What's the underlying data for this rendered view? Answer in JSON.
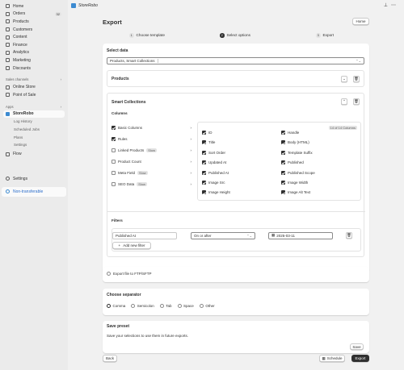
{
  "sidebar": {
    "items": [
      {
        "label": "Home",
        "icon": "home-icon"
      },
      {
        "label": "Orders",
        "icon": "orders-icon",
        "badge": "32"
      },
      {
        "label": "Products",
        "icon": "tag-icon"
      },
      {
        "label": "Customers",
        "icon": "person-icon"
      },
      {
        "label": "Content",
        "icon": "content-icon"
      },
      {
        "label": "Finance",
        "icon": "bank-icon"
      },
      {
        "label": "Analytics",
        "icon": "chart-icon"
      },
      {
        "label": "Marketing",
        "icon": "target-icon"
      },
      {
        "label": "Discounts",
        "icon": "discount-icon"
      }
    ],
    "sales_channels_label": "Sales channels",
    "channels": [
      {
        "label": "Online Store",
        "icon": "store-icon"
      },
      {
        "label": "Point of Sale",
        "icon": "pos-icon"
      }
    ],
    "apps_label": "Apps",
    "app": {
      "label": "StoreRobo",
      "icon": "app-icon"
    },
    "app_sub": [
      "Log History",
      "Scheduled Jobs",
      "Plans",
      "Settings"
    ],
    "flow": "Flow",
    "settings": "Settings",
    "non_transferable": "Non-transferable"
  },
  "topbar": {
    "title": "StoreRobo"
  },
  "page": {
    "title": "Export",
    "home_button": "Home"
  },
  "steps": [
    {
      "num": "1",
      "label": "Choose template"
    },
    {
      "num": "2",
      "label": "Select options"
    },
    {
      "num": "3",
      "label": "Export"
    }
  ],
  "select_data": {
    "heading": "Select data",
    "value": "Products, Smart Collections",
    "products": "Products",
    "smart_collections": "Smart Collections",
    "columns_label": "Columns",
    "groups": [
      {
        "label": "Basic Columns",
        "checked": true
      },
      {
        "label": "Rules",
        "checked": true
      },
      {
        "label": "Linked Products",
        "checked": false,
        "pill": "Slow"
      },
      {
        "label": "Product Count",
        "checked": false
      },
      {
        "label": "Meta Field",
        "checked": false,
        "pill": "Slow"
      },
      {
        "label": "SEO Data",
        "checked": false,
        "pill": "Slow"
      }
    ],
    "count_badge": "14 of 14 Columns",
    "columns_left": [
      "ID",
      "Title",
      "Sort Order",
      "Updated At",
      "Published At",
      "Image Src",
      "Image Height"
    ],
    "columns_right": [
      "Handle",
      "Body (HTML)",
      "Template Suffix",
      "Published",
      "Published Scope",
      "Image Width",
      "Image Alt Text"
    ],
    "filters_label": "Filters",
    "filter_field": "Published At",
    "filter_op": "On or after",
    "filter_value": "2025-03-11",
    "add_filter": "Add new filter"
  },
  "ftp": {
    "label": "Export file to FTP/SFTP"
  },
  "separator": {
    "heading": "Choose separator",
    "options": [
      "Comma",
      "Semicolon",
      "Tab",
      "Space",
      "Other"
    ],
    "selected": "Comma"
  },
  "preset": {
    "heading": "Save preset",
    "description": "Save your selections to use them in future exports.",
    "save": "Save"
  },
  "footer": {
    "back": "Back",
    "schedule": "Schedule",
    "export": "Export"
  }
}
